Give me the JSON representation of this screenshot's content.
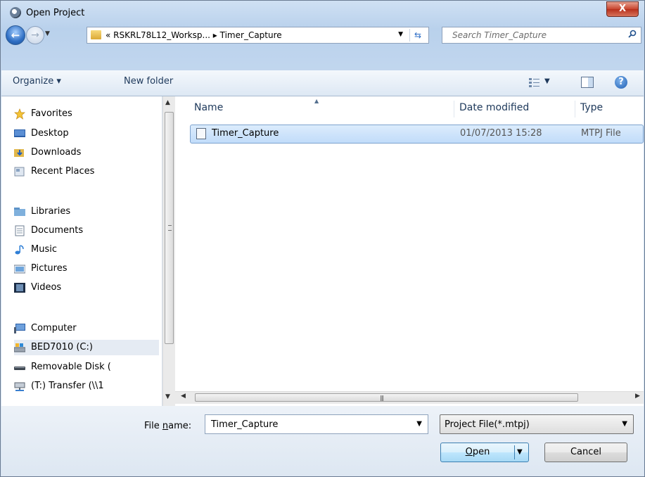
{
  "window": {
    "title": "Open Project",
    "close_label": "X"
  },
  "address": {
    "path_prefix": "«",
    "path_segments": [
      "RSKRL78L12_Worksp...",
      "Timer_Capture"
    ],
    "separator": "▸",
    "search_placeholder": "Search Timer_Capture"
  },
  "toolbar": {
    "organize_label": "Organize ▾",
    "new_folder_label": "New folder"
  },
  "nav": {
    "favorites": {
      "label": "Favorites",
      "items": [
        "Desktop",
        "Downloads",
        "Recent Places"
      ]
    },
    "libraries": {
      "label": "Libraries",
      "items": [
        "Documents",
        "Music",
        "Pictures",
        "Videos"
      ]
    },
    "computer": {
      "label": "Computer",
      "items": [
        "BED7010 (C:)",
        "Removable Disk (",
        "(T:) Transfer (\\\\1"
      ]
    }
  },
  "columns": {
    "name": "Name",
    "date": "Date modified",
    "type": "Type"
  },
  "files": [
    {
      "name": "Timer_Capture",
      "date": "01/07/2013 15:28",
      "type": "MTPJ File"
    }
  ],
  "bottom": {
    "file_name_label_pre": "File ",
    "file_name_label_u": "n",
    "file_name_label_post": "ame:",
    "file_name_value": "Timer_Capture",
    "file_type_value": "Project File(*.mtpj)",
    "open_label_u": "O",
    "open_label_rest": "pen",
    "cancel_label": "Cancel"
  },
  "colors": {
    "accent": "#3c7fb1",
    "selection": "#c1dcfa",
    "close": "#c8452f"
  }
}
